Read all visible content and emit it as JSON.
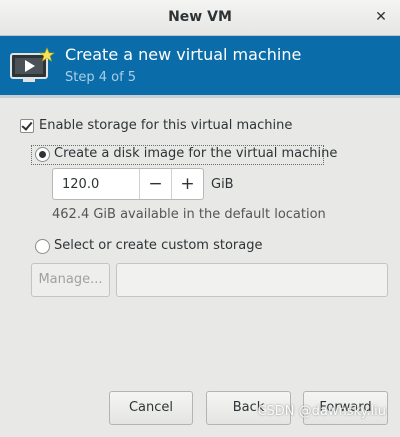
{
  "window": {
    "title": "New VM"
  },
  "banner": {
    "heading": "Create a new virtual machine",
    "step": "Step 4 of 5",
    "icon": "monitor-with-star-icon"
  },
  "storage": {
    "enable_label": "Enable storage for this virtual machine",
    "enable_checked": true,
    "create_disk_label": "Create a disk image for the virtual machine",
    "create_disk_selected": true,
    "size_value": "120.0",
    "size_unit": "GiB",
    "available_text": "462.4 GiB available in the default location",
    "custom_label": "Select or create custom storage",
    "custom_selected": false,
    "manage_label": "Manage...",
    "path_value": ""
  },
  "footer": {
    "cancel_label": "Cancel",
    "back_label": "Back",
    "forward_label": "Forward"
  },
  "watermark": "CSDN @dawnsky.liu",
  "colors": {
    "banner": "#0a6ca8",
    "banner_subtext": "#a9cfe8",
    "window_bg": "#e8e8e7"
  }
}
